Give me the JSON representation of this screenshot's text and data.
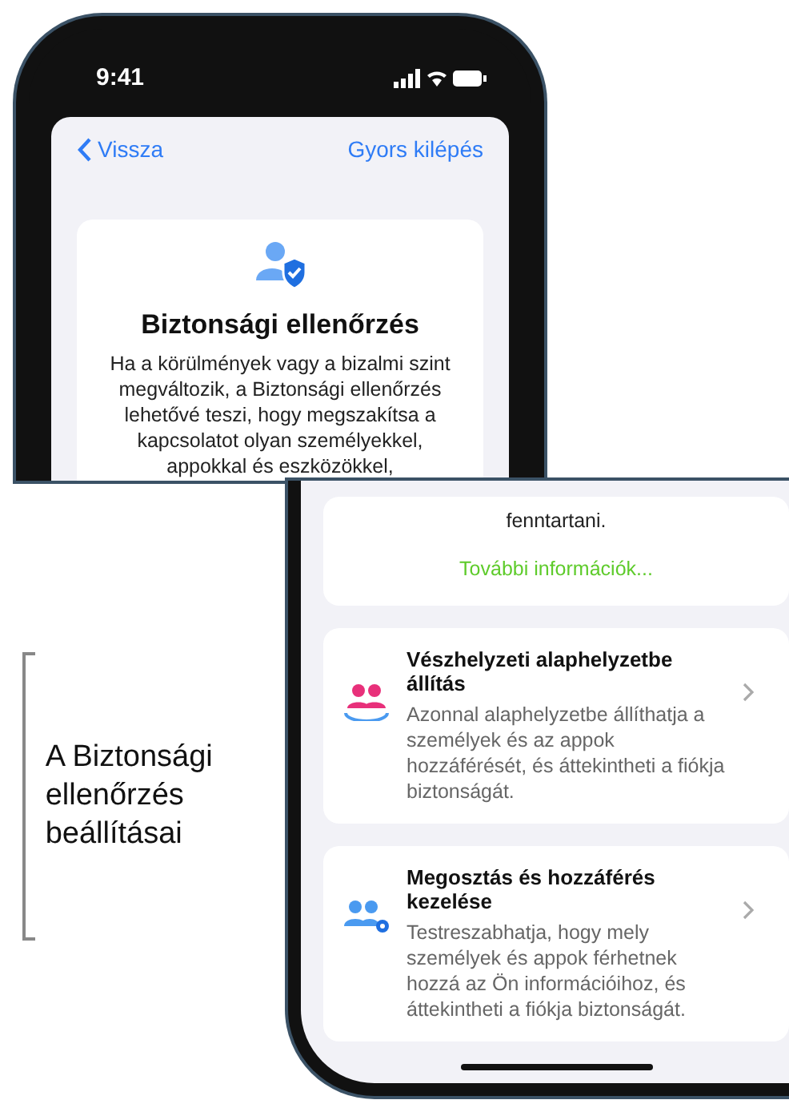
{
  "status_bar": {
    "time": "9:41"
  },
  "nav": {
    "back": "Vissza",
    "quick_exit": "Gyors kilépés"
  },
  "intro": {
    "title": "Biztonsági ellenőrzés",
    "text": "Ha a körülmények vagy a bizalmi szint megváltozik, a Biztonsági ellenőrzés lehetővé teszi, hogy megszakítsa a kapcsolatot olyan személyekkel, appokkal és eszközökkel,",
    "tail": "fenntartani.",
    "link": "További információk..."
  },
  "options": [
    {
      "kind": "reset",
      "title": "Vészhelyzeti alaphelyzetbe állítás",
      "text": "Azonnal alaphelyzetbe állíthatja a személyek és az appok hozzáférését, és áttekintheti a fiókja biztonságát."
    },
    {
      "kind": "manage",
      "title": "Megosztás és hozzáférés kezelése",
      "text": "Testreszabhatja, hogy mely személyek és appok férhetnek hozzá az Ön információihoz, és áttekintheti a fiókja biztonságát."
    }
  ],
  "callout": "A Biztonsági ellenőrzés beállításai"
}
